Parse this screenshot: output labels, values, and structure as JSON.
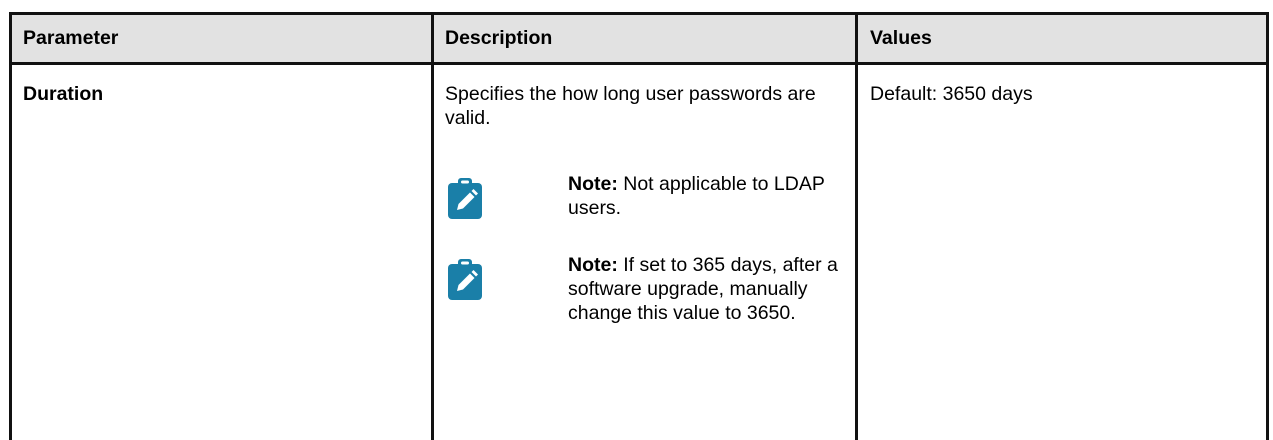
{
  "table": {
    "headers": [
      "Parameter",
      "Description",
      "Values"
    ],
    "rows": [
      {
        "parameter": "Duration",
        "description": "Specifies the how long user passwords are valid.",
        "notes": [
          {
            "label": "Note:",
            "text": "Not applicable to LDAP users.",
            "icon": "note-clipboard-pencil-icon"
          },
          {
            "label": "Note:",
            "text": "If set to 365 days, after a software upgrade, manually change this value to 3650.",
            "icon": "note-clipboard-pencil-icon"
          }
        ],
        "values": "Default: 3650 days"
      }
    ]
  },
  "colors": {
    "header_bg": "#e2e2e2",
    "border": "#111111",
    "note_icon": "#1a7fa8"
  }
}
